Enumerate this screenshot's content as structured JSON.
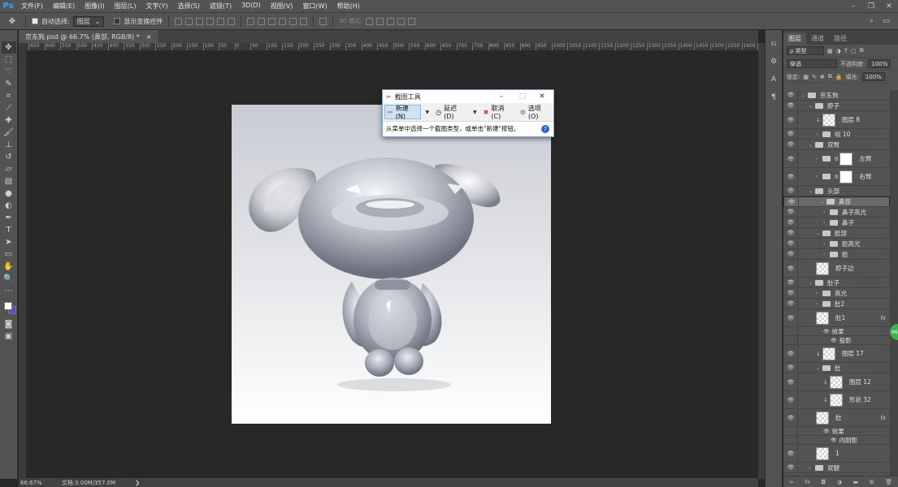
{
  "app": {
    "logo": "Ps"
  },
  "menu": [
    "文件(F)",
    "编辑(E)",
    "图像(I)",
    "图层(L)",
    "文字(Y)",
    "选择(S)",
    "滤镜(T)",
    "3D(D)",
    "视图(V)",
    "窗口(W)",
    "帮助(H)"
  ],
  "options": {
    "auto_select_label": "自动选择:",
    "auto_select_value": "图层",
    "show_transform_label": "显示变换控件",
    "mode_3d_label": "3D 模式:"
  },
  "document": {
    "tab_title": "京东狗.psd @ 66.7% (鼻部, RGB/8) *",
    "close": "×"
  },
  "ruler_ticks": [
    "650",
    "600",
    "550",
    "500",
    "450",
    "400",
    "350",
    "300",
    "250",
    "200",
    "150",
    "100",
    "50",
    "0",
    "50",
    "100",
    "150",
    "200",
    "250",
    "300",
    "350",
    "400",
    "450",
    "500",
    "550",
    "600",
    "650",
    "700",
    "750",
    "800",
    "850",
    "900",
    "950",
    "1000",
    "1050",
    "1100",
    "1150",
    "1200",
    "1250",
    "1300",
    "1350",
    "1400",
    "1450",
    "1500",
    "1550",
    "1600",
    "1650"
  ],
  "status": {
    "zoom": "66.67%",
    "doc_info": "文档:3.00M/357.0M",
    "arrow": "❯"
  },
  "snipping_tool": {
    "title": "截图工具",
    "new_label": "新建(N)",
    "delay_label": "延迟(D)",
    "cancel_label": "取消(C)",
    "options_label": "选项(O)",
    "message": "从菜单中选择一个截图类型，或单击\"新建\"按钮。",
    "help": "?"
  },
  "layers_panel": {
    "tabs": [
      "图层",
      "通道",
      "路径"
    ],
    "filter_kind": "ρ 类型",
    "blend_mode": "穿透",
    "opacity_label": "不透明度:",
    "opacity_value": "100%",
    "lock_label": "锁定:",
    "fill_label": "填充:",
    "fill_value": "100%",
    "layers": [
      {
        "name": "京东狗",
        "kind": "group",
        "indent": 0,
        "open": true
      },
      {
        "name": "脖子",
        "kind": "group",
        "indent": 1,
        "open": true
      },
      {
        "name": "图层 8",
        "kind": "layer",
        "indent": 2,
        "clip": true
      },
      {
        "name": "组 10",
        "kind": "group",
        "indent": 2,
        "open": false
      },
      {
        "name": "双臂",
        "kind": "group",
        "indent": 1,
        "open": true
      },
      {
        "name": "左臂",
        "kind": "group-mask",
        "indent": 2,
        "open": false
      },
      {
        "name": "右臂",
        "kind": "group-mask",
        "indent": 2,
        "open": false
      },
      {
        "name": "头部",
        "kind": "group",
        "indent": 1,
        "open": true
      },
      {
        "name": "鼻部",
        "kind": "group",
        "indent": 2,
        "open": true,
        "selected": true
      },
      {
        "name": "鼻子高光",
        "kind": "group",
        "indent": 3,
        "open": false
      },
      {
        "name": "鼻子",
        "kind": "group",
        "indent": 3,
        "open": false
      },
      {
        "name": "脸部",
        "kind": "group",
        "indent": 2,
        "open": true
      },
      {
        "name": "脸高光",
        "kind": "group",
        "indent": 3,
        "open": false
      },
      {
        "name": "脸",
        "kind": "group",
        "indent": 3,
        "open": false
      },
      {
        "name": "脖子边",
        "kind": "layer",
        "indent": 2
      },
      {
        "name": "肚子",
        "kind": "group",
        "indent": 1,
        "open": true
      },
      {
        "name": "高光",
        "kind": "group",
        "indent": 2,
        "open": false
      },
      {
        "name": "肚2",
        "kind": "group",
        "indent": 2,
        "open": false
      },
      {
        "name": "肚1",
        "kind": "layer",
        "indent": 2,
        "fx": "fx"
      },
      {
        "name": "效果",
        "kind": "effect",
        "indent": 3
      },
      {
        "name": "投影",
        "kind": "effect",
        "indent": 4
      },
      {
        "name": "图层 17",
        "kind": "layer",
        "indent": 2,
        "clip": true
      },
      {
        "name": "肚",
        "kind": "group",
        "indent": 2,
        "open": true
      },
      {
        "name": "图层 12",
        "kind": "layer",
        "indent": 3,
        "clip": true
      },
      {
        "name": "形状 32",
        "kind": "layer",
        "indent": 3,
        "clip": true
      },
      {
        "name": "肚",
        "kind": "layer",
        "indent": 2,
        "fx": "fx"
      },
      {
        "name": "效果",
        "kind": "effect",
        "indent": 3
      },
      {
        "name": "内阴影",
        "kind": "effect",
        "indent": 4
      },
      {
        "name": "1",
        "kind": "layer",
        "indent": 2
      },
      {
        "name": "双腿",
        "kind": "group",
        "indent": 1,
        "open": false
      }
    ]
  },
  "badge": "66"
}
